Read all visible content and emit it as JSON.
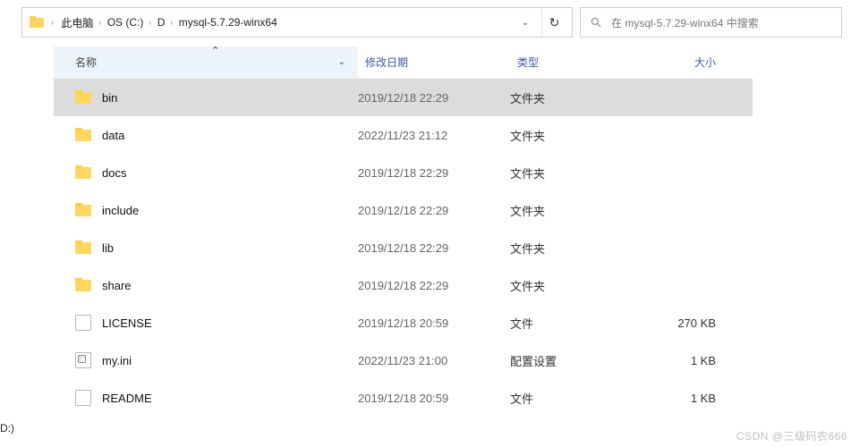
{
  "breadcrumbs": [
    "此电脑",
    "OS (C:)",
    "D",
    "mysql-5.7.29-winx64"
  ],
  "search_placeholder": "在 mysql-5.7.29-winx64 中搜索",
  "columns": {
    "name": "名称",
    "date": "修改日期",
    "type": "类型",
    "size": "大小"
  },
  "rows": [
    {
      "icon": "folder",
      "name": "bin",
      "date": "2019/12/18 22:29",
      "type": "文件夹",
      "size": "",
      "selected": true
    },
    {
      "icon": "folder",
      "name": "data",
      "date": "2022/11/23 21:12",
      "type": "文件夹",
      "size": "",
      "selected": false
    },
    {
      "icon": "folder",
      "name": "docs",
      "date": "2019/12/18 22:29",
      "type": "文件夹",
      "size": "",
      "selected": false
    },
    {
      "icon": "folder",
      "name": "include",
      "date": "2019/12/18 22:29",
      "type": "文件夹",
      "size": "",
      "selected": false
    },
    {
      "icon": "folder",
      "name": "lib",
      "date": "2019/12/18 22:29",
      "type": "文件夹",
      "size": "",
      "selected": false
    },
    {
      "icon": "folder",
      "name": "share",
      "date": "2019/12/18 22:29",
      "type": "文件夹",
      "size": "",
      "selected": false
    },
    {
      "icon": "file",
      "name": "LICENSE",
      "date": "2019/12/18 20:59",
      "type": "文件",
      "size": "270 KB",
      "selected": false
    },
    {
      "icon": "ini",
      "name": "my.ini",
      "date": "2022/11/23 21:00",
      "type": "配置设置",
      "size": "1 KB",
      "selected": false
    },
    {
      "icon": "file",
      "name": "README",
      "date": "2019/12/18 20:59",
      "type": "文件",
      "size": "1 KB",
      "selected": false
    }
  ],
  "sidebar_drive": "D:)",
  "watermark": "CSDN @三级码农666"
}
